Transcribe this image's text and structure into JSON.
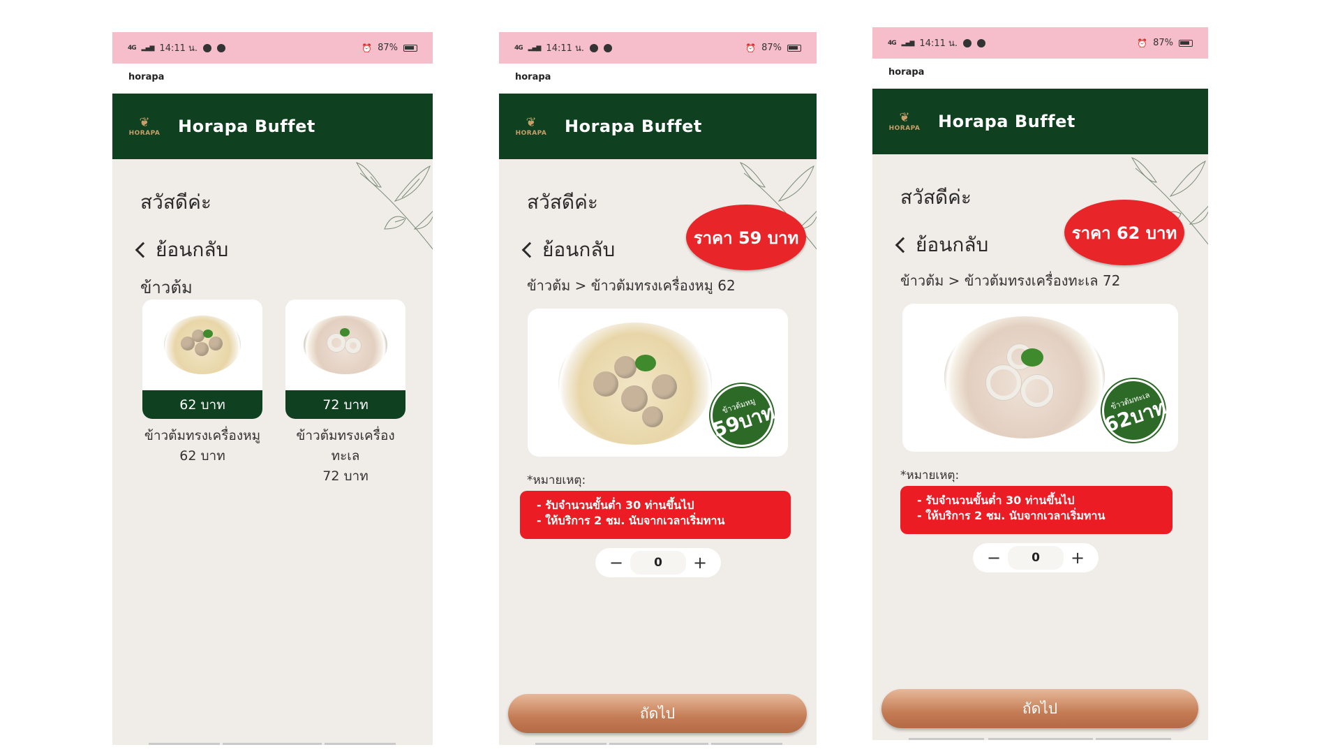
{
  "status": {
    "time": "14:11 น.",
    "network": "4G",
    "battery": "87%"
  },
  "app_host": "horapa",
  "brand": {
    "logo_text": "HORAPA",
    "title": "Horapa Buffet"
  },
  "greeting": "สวัสดีค่ะ",
  "back_label": "ย้อนกลับ",
  "screen1": {
    "category": "ข้าวต้ม",
    "items": [
      {
        "price_label": "62 บาท",
        "name_line1": "ข้าวต้มทรงเครื่องหมู",
        "name_line2": "62 บาท",
        "name_line3": ""
      },
      {
        "price_label": "72 บาท",
        "name_line1": "ข้าวต้มทรงเครื่อง",
        "name_line2": "ทะเล",
        "name_line3": "72 บาท"
      }
    ]
  },
  "screen2": {
    "price_badge": "ราคา 59 บาท",
    "breadcrumb": "ข้าวต้ม > ข้าวต้มทรงเครื่องหมู 62",
    "photo_badge_top": "ข้าวต้มหมู",
    "photo_badge_num": "59บาท",
    "note_label": "*หมายเหตุ:",
    "notes": [
      "- รับจำนวนขั้นต่ำ 30 ท่านขึ้นไป",
      "- ให้บริการ 2 ชม. นับจากเวลาเริ่มทาน"
    ],
    "stepper": {
      "minus": "−",
      "qty": "0",
      "plus": "+"
    },
    "next_label": "ถัดไป"
  },
  "screen3": {
    "price_badge": "ราคา 62 บาท",
    "breadcrumb": "ข้าวต้ม > ข้าวต้มทรงเครื่องทะเล 72",
    "photo_badge_top": "ข้าวต้มทะเล",
    "photo_badge_num": "62บาท",
    "note_label": "*หมายเหตุ:",
    "notes": [
      "- รับจำนวนขั้นต่ำ 30 ท่านขึ้นไป",
      "- ให้บริการ 2 ชม. นับจากเวลาเริ่มทาน"
    ],
    "stepper": {
      "minus": "−",
      "qty": "0",
      "plus": "+"
    },
    "next_label": "ถัดไป"
  },
  "colors": {
    "header_green": "#0f4120",
    "status_pink": "#f6bdcb",
    "accent_red": "#ec1c24",
    "button_brown": "#c47c55",
    "page_bg": "#f0ece7"
  }
}
